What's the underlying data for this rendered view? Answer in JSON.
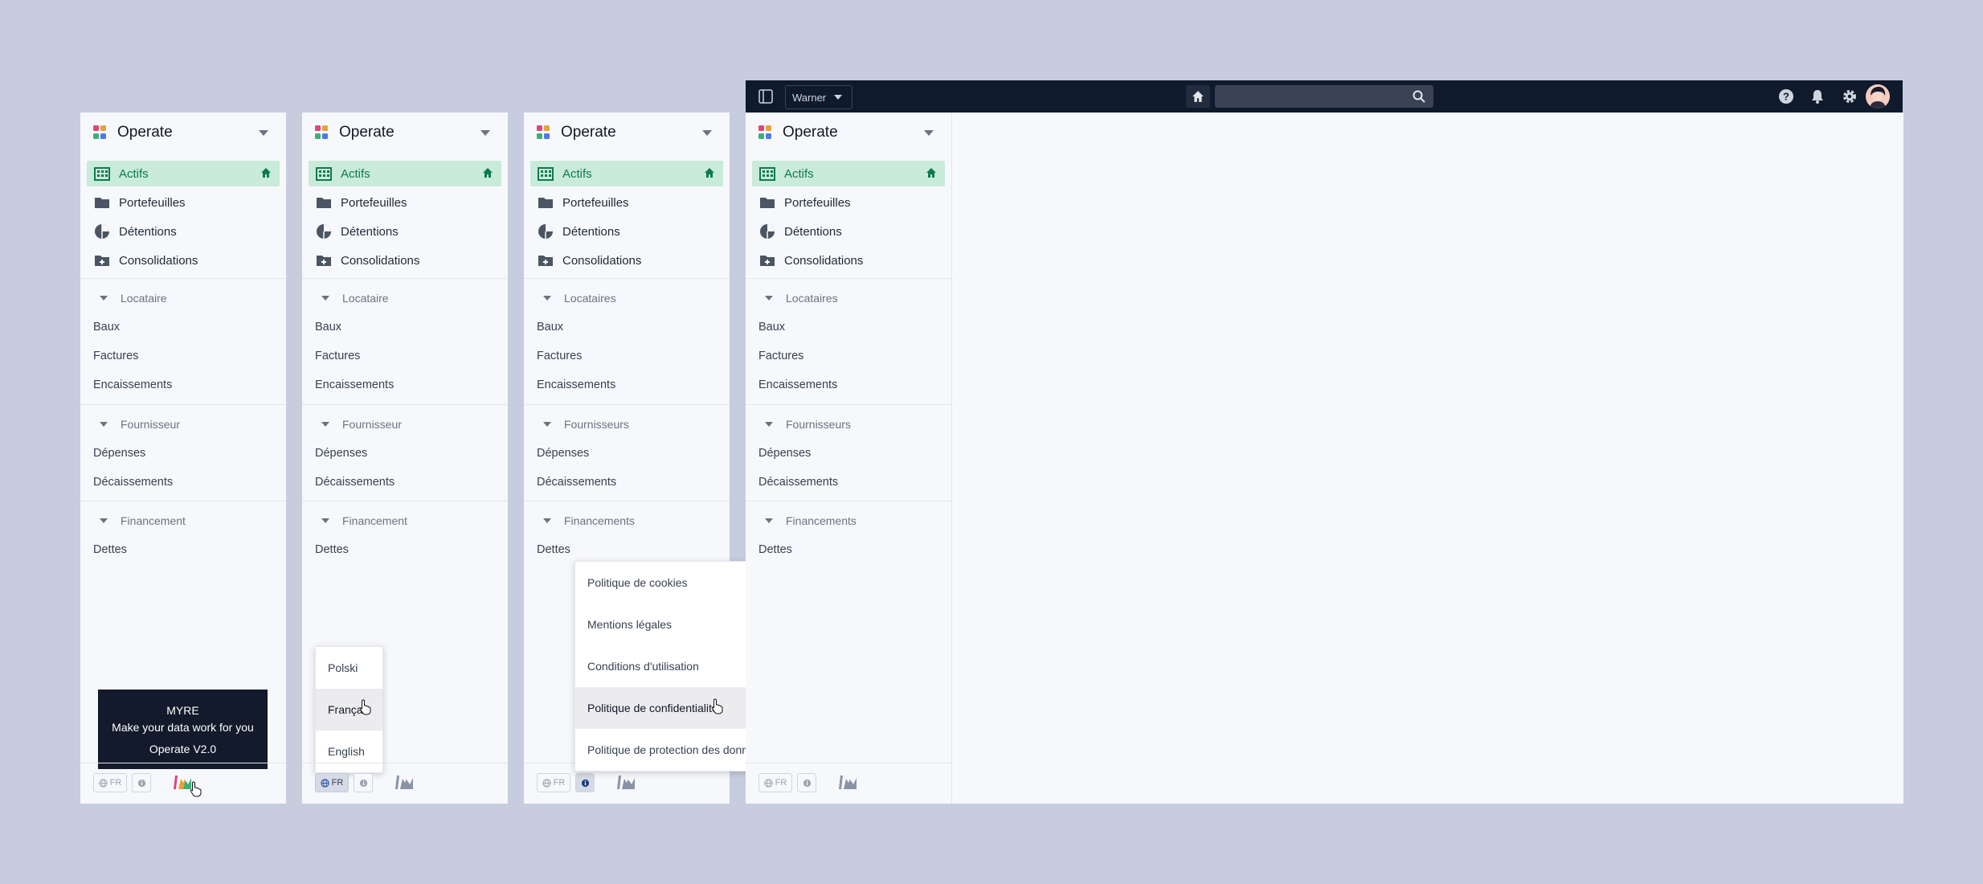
{
  "app": {
    "name": "Operate"
  },
  "nav": {
    "primary": [
      "Actifs",
      "Portefeuilles",
      "Détentions",
      "Consolidations"
    ]
  },
  "sections_v1": {
    "tenant": "Locataire",
    "supplier": "Fournisseur",
    "financing": "Financement"
  },
  "sections_v2": {
    "tenant": "Locataires",
    "supplier": "Fournisseurs",
    "financing": "Financements"
  },
  "items": {
    "tenant": [
      "Baux",
      "Factures",
      "Encaissements"
    ],
    "supplier": [
      "Dépenses",
      "Décaissements"
    ],
    "financing": [
      "Dettes"
    ]
  },
  "footer": {
    "lang": "FR"
  },
  "tooltip": {
    "title": "MYRE",
    "tagline": "Make your data work for you",
    "version": "Operate V2.0"
  },
  "language_menu": [
    "Polski",
    "Français",
    "English"
  ],
  "legal_menu": [
    "Politique de cookies",
    "Mentions légales",
    "Conditions d'utilisation",
    "Politique de confidentialité",
    "Politique de protection des données"
  ],
  "topbar": {
    "workspace": "Warner"
  },
  "colors": {
    "accent": "#0e7a4e",
    "active_bg": "#c8ebda",
    "topbar": "#0f1a2c",
    "tooltip": "#121a2b"
  },
  "icons": {
    "nav": [
      "buildings-icon",
      "folder-icon",
      "pie-chart-icon",
      "folder-plus-icon"
    ],
    "topbar": [
      "sidebar-toggle-icon",
      "home-icon",
      "search-icon",
      "help-icon",
      "bell-icon",
      "gear-icon"
    ]
  }
}
